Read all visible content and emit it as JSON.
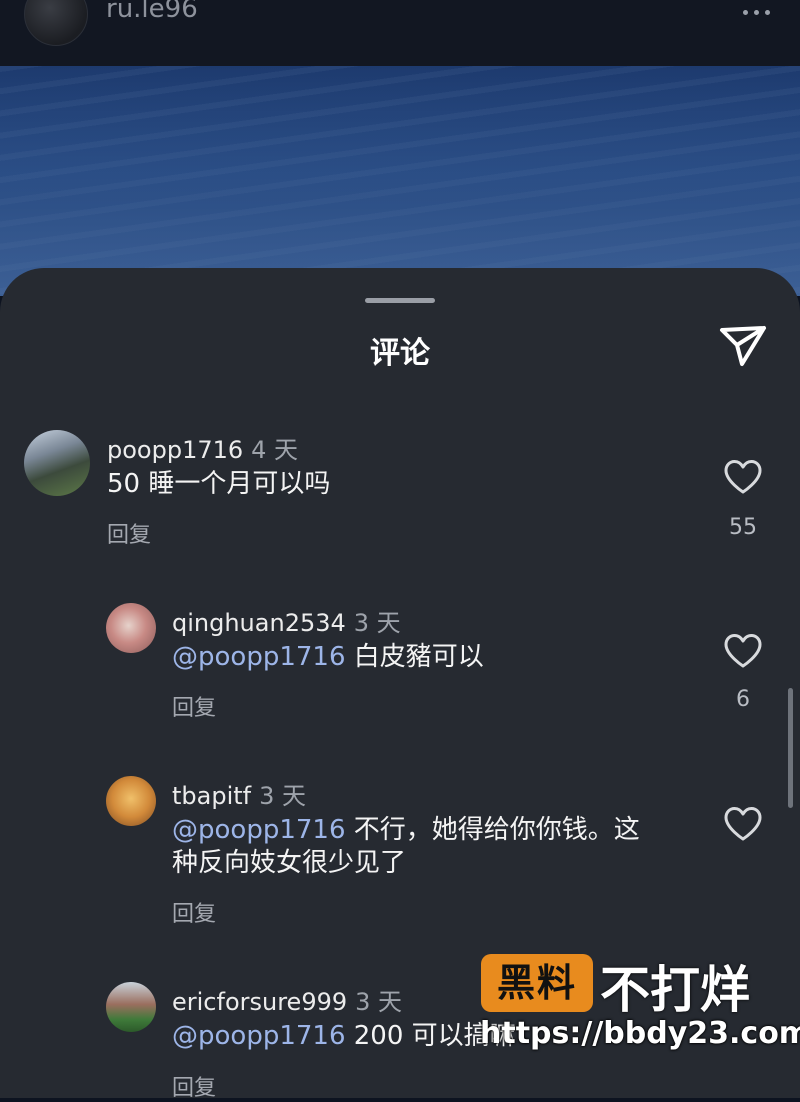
{
  "header": {
    "username": "ru.le96",
    "more_icon": "more-horizontal-icon"
  },
  "sheet": {
    "title": "评论",
    "send_icon": "send-icon"
  },
  "comments": [
    {
      "username": "poopp1716",
      "time": "4 天",
      "mention": "",
      "text": "50 睡一个月可以吗",
      "reply_label": "回复",
      "likes": "55"
    },
    {
      "username": "qinghuan2534",
      "time": "3 天",
      "mention": "@poopp1716",
      "text": "白皮豬可以",
      "reply_label": "回复",
      "likes": "6"
    },
    {
      "username": "tbapitf",
      "time": "3 天",
      "mention": "@poopp1716",
      "text_line1": "不行，她得给你你钱。这",
      "text_line2": "种反向妓女很少见了",
      "reply_label": "回复",
      "likes": ""
    },
    {
      "username": "ericforsure999",
      "time": "3 天",
      "mention": "@poopp1716",
      "text": "200 可以搞嘛",
      "reply_label": "回复",
      "likes": ""
    }
  ],
  "watermark": {
    "badge": "黑料",
    "text": "不打烊",
    "url": "https://bbdy23.com"
  },
  "colors": {
    "sheet_bg": "#262a31",
    "mention": "#9db5e8",
    "watermark_badge": "#e88b1e"
  }
}
